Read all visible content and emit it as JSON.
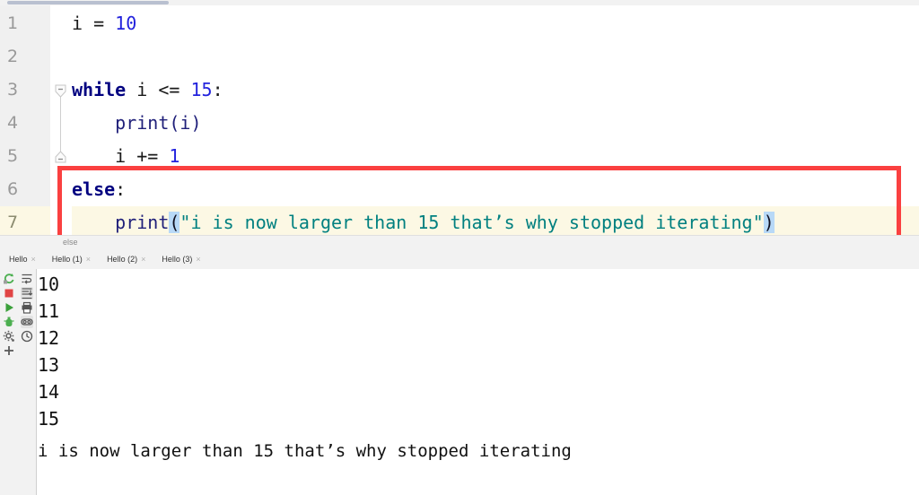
{
  "editor": {
    "lines": [
      {
        "number": "1",
        "active": false,
        "tokens": [
          {
            "t": "plain",
            "s": "i = "
          },
          {
            "t": "num",
            "s": "10"
          }
        ]
      },
      {
        "number": "2",
        "active": false,
        "tokens": []
      },
      {
        "number": "3",
        "active": false,
        "tokens": [
          {
            "t": "kw",
            "s": "while"
          },
          {
            "t": "plain",
            "s": " i <= "
          },
          {
            "t": "num",
            "s": "15"
          },
          {
            "t": "plain",
            "s": ":"
          }
        ]
      },
      {
        "number": "4",
        "active": false,
        "tokens": [
          {
            "t": "fn",
            "s": "    print(i)"
          }
        ]
      },
      {
        "number": "5",
        "active": false,
        "tokens": [
          {
            "t": "plain",
            "s": "    i += "
          },
          {
            "t": "num",
            "s": "1"
          }
        ]
      },
      {
        "number": "6",
        "active": false,
        "tokens": [
          {
            "t": "kw",
            "s": "else"
          },
          {
            "t": "plain",
            "s": ":"
          }
        ]
      },
      {
        "number": "7",
        "active": true,
        "tokens": [
          {
            "t": "fn",
            "s": "    print"
          },
          {
            "t": "brkt",
            "s": "("
          },
          {
            "t": "str",
            "s": "\"i is now larger than 15 that’s why stopped iterating\""
          },
          {
            "t": "brkt",
            "s": ")"
          }
        ]
      }
    ],
    "fold_markers": [
      {
        "line": 3,
        "icon": "fold-collapse-icon"
      },
      {
        "line": 5,
        "icon": "fold-end-icon"
      }
    ]
  },
  "breadcrumb": {
    "text": "else"
  },
  "tabs": [
    {
      "label": "Hello",
      "close": "×",
      "active": false
    },
    {
      "label": "Hello (1)",
      "close": "×",
      "active": false
    },
    {
      "label": "Hello (2)",
      "close": "×",
      "active": false
    },
    {
      "label": "Hello (3)",
      "close": "×",
      "active": true
    }
  ],
  "console": {
    "toolbar_left": [
      {
        "icon": "rerun-icon",
        "color": "#4caf50"
      },
      {
        "icon": "stop-icon",
        "color": "#e04545"
      },
      {
        "icon": "run-icon",
        "color": "#3aa03a"
      },
      {
        "icon": "debug-icon",
        "color": "#4caf50"
      },
      {
        "icon": "settings-icon",
        "color": "#606060"
      },
      {
        "icon": "plus-icon",
        "color": "#5a5a5a"
      }
    ],
    "toolbar_right": [
      {
        "icon": "soft-wrap-icon",
        "color": "#555555",
        "boxed": false
      },
      {
        "icon": "scroll-to-end-icon",
        "color": "#555555",
        "boxed": true
      },
      {
        "icon": "print-icon",
        "color": "#555555",
        "boxed": false
      },
      {
        "icon": "use-console-icon",
        "color": "#555555",
        "boxed": true
      },
      {
        "icon": "history-icon",
        "color": "#555555",
        "boxed": false
      }
    ],
    "output_lines": [
      "10",
      "11",
      "12",
      "13",
      "14",
      "15"
    ],
    "output_final": "i is now larger than 15 that’s why stopped iterating"
  },
  "annotations": {
    "highlight_color": "#fa4040",
    "else_block_box_label": "else-block-highlight",
    "output_box_label": "output-line-highlight"
  },
  "colors": {
    "keyword": "#000080",
    "number": "#2222dd",
    "string": "#008080",
    "function": "#20207a",
    "active_line_bg": "#fcf8e4",
    "bracket_highlight_bg": "#b8d9f7",
    "gutter_bg": "#f0f0f0"
  }
}
